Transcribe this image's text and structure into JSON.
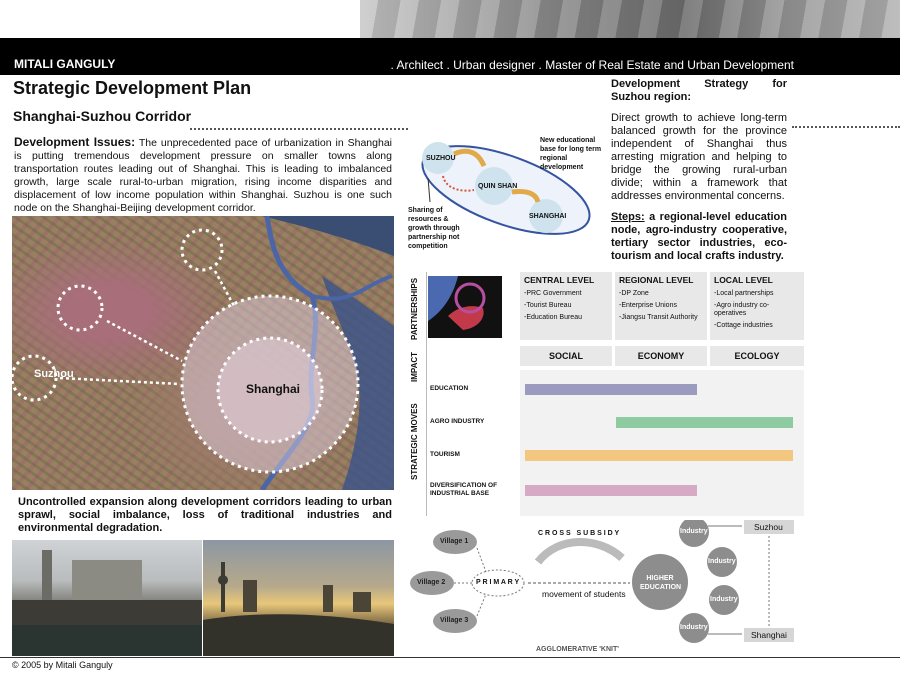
{
  "header": {
    "name": "MITALI GANGULY",
    "tagline": ". Architect  .  Urban designer  .  Master of Real Estate and Urban Development"
  },
  "title": "Strategic Development Plan",
  "subtitle": "Shanghai-Suzhou Corridor",
  "issues": {
    "label": "Development Issues:",
    "text": " The unprecedented pace of urbanization in Shanghai is putting tremendous development pressure on smaller towns along transportation routes leading out of Shanghai. This is leading to imbalanced growth, large scale rural-to-urban migration, rising income disparities and displacement of low income population within Shanghai. Suzhou is one such node on the Shanghai-Beijing development corridor."
  },
  "map": {
    "suzhou": "Suzhou",
    "shanghai": "Shanghai"
  },
  "uncontrolled": "Uncontrolled expansion along development corridors leading to urban sprawl, social imbalance, loss of traditional industries and environmental degradation.",
  "strategy": {
    "title": "Development Strategy for Suzhou region:",
    "body": "Direct growth to achieve long-term balanced growth for the province independent of Shanghai thus arresting migration and helping to bridge the growing rural-urban divide; within a framework that addresses environmental concerns.",
    "steps_label": "Steps:",
    "steps_text": " a regional-level education node, agro-industry cooperative, tertiary sector industries, eco-tourism and local crafts industry."
  },
  "node_diagram": {
    "suzhou": "SUZHOU",
    "quinshan": "QUIN SHAN",
    "shanghai": "SHANGHAI",
    "note_top": "New educational base for long term regional development",
    "note_left": "Sharing of resources & growth through partnership not competition"
  },
  "matrix": {
    "side_partnerships": "PARTNERSHIPS",
    "side_impact": "IMPACT",
    "side_moves": "STRATEGIC MOVES",
    "levels": [
      {
        "title": "CENTRAL LEVEL",
        "items": [
          "-PRC Government",
          "-Tourist Bureau",
          "-Education Bureau"
        ]
      },
      {
        "title": "REGIONAL LEVEL",
        "items": [
          "-DP Zone",
          "-Enterprise Unions",
          "-Jiangsu Transit Authority"
        ]
      },
      {
        "title": "LOCAL LEVEL",
        "items": [
          "-Local partnerships",
          "-Agro industry co-operatives",
          "-Cottage industries"
        ]
      }
    ],
    "impacts": [
      "SOCIAL",
      "ECONOMY",
      "ECOLOGY"
    ],
    "moves": [
      {
        "label": "EDUCATION",
        "start": 0.0,
        "end": 0.64,
        "color": "#9b9bbf"
      },
      {
        "label": "AGRO INDUSTRY",
        "start": 0.34,
        "end": 1.0,
        "color": "#8fcba0"
      },
      {
        "label": "TOURISM",
        "start": 0.0,
        "end": 1.0,
        "color": "#f3c77f"
      },
      {
        "label": "DIVERSIFICATION OF INDUSTRIAL BASE",
        "start": 0.0,
        "end": 0.64,
        "color": "#d6a9c4"
      }
    ]
  },
  "edu": {
    "villages": [
      "Village 1",
      "Village 2",
      "Village 3"
    ],
    "primary": "P R I M A R Y",
    "cross_subsidy": "C R O S S   S U B S I D Y",
    "movement": "movement of students",
    "higher": "HIGHER EDUCATION",
    "industry": "Industry",
    "suzhou": "Suzhou",
    "shanghai": "Shanghai",
    "agglomerative": "AGGLOMERATIVE 'KNIT'"
  },
  "copyright": "© 2005 by Mitali Ganguly"
}
